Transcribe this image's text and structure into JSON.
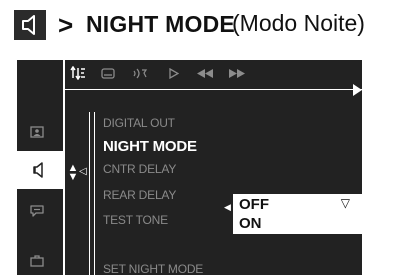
{
  "heading": {
    "arrow": ">",
    "title": "NIGHT MODE",
    "subtitle": "(Modo Noite)",
    "icon": "speaker-icon"
  },
  "osd": {
    "top_icons": [
      "audio-setup-icon",
      "subtitle-icon",
      "audio-language-icon",
      "play-icon",
      "rewind-icon",
      "fast-forward-icon"
    ],
    "side_icons": [
      "picture-setup-icon",
      "speaker-icon",
      "subtitle-bubble-icon",
      "briefcase-icon"
    ],
    "menu": {
      "items": [
        {
          "label": "DIGITAL OUT"
        },
        {
          "label": "NIGHT MODE"
        },
        {
          "label": "CNTR DELAY"
        },
        {
          "label": "REAR DELAY"
        },
        {
          "label": "TEST TONE"
        }
      ],
      "status": "SET NIGHT MODE"
    },
    "dropdown": {
      "options": [
        "OFF",
        "ON"
      ],
      "selected": "OFF"
    }
  }
}
